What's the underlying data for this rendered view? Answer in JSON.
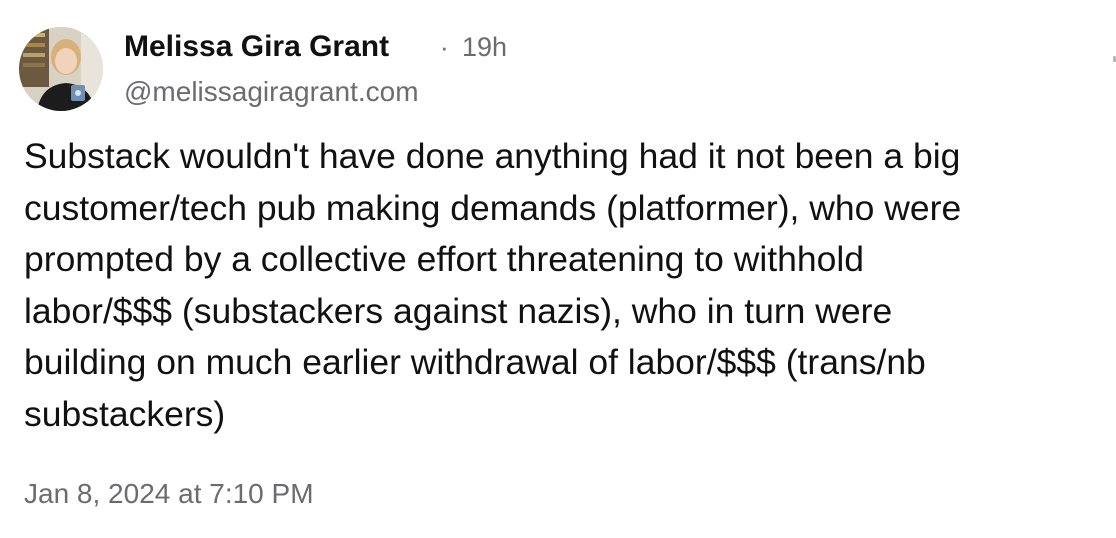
{
  "post": {
    "author_name": "Melissa Gira Grant",
    "separator": "·",
    "age": "19h",
    "handle": "@melissagiragrant.com",
    "avatar": "avatar-photo",
    "body": "Substack wouldn't have done anything had it not been a big\ncustomer/tech pub making demands (platformer), who were\nprompted by a collective effort threatening to withhold\nlabor/$$$ (substackers against nazis), who in turn were\nbuilding on much earlier withdrawal of labor/$$$ (trans/nb\nsubstackers)",
    "timestamp": "Jan 8, 2024 at 7:10 PM"
  },
  "colors": {
    "text_primary": "#111111",
    "text_secondary": "#6b6b70",
    "background": "#ffffff"
  }
}
